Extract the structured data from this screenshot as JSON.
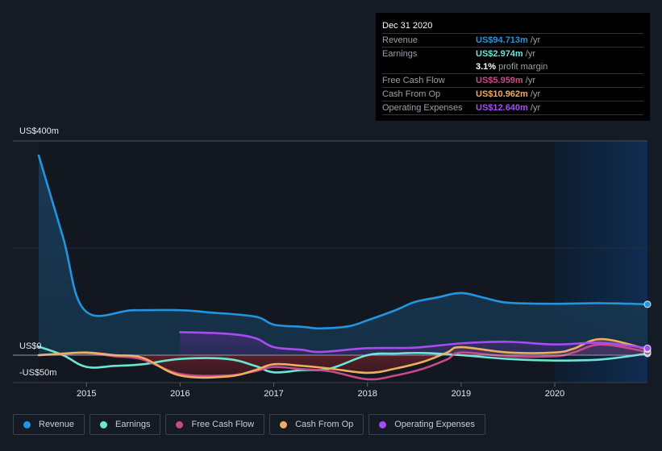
{
  "tooltip": {
    "date": "Dec 31 2020",
    "rows": [
      {
        "label": "Revenue",
        "value": "US$94.713m",
        "unit": " /yr",
        "color": "#2394df"
      },
      {
        "label": "Earnings",
        "value": "US$2.974m",
        "unit": " /yr",
        "color": "#6ce5d5"
      },
      {
        "label": "",
        "value": "3.1%",
        "unit": " profit margin",
        "color": "#ffffff"
      },
      {
        "label": "Free Cash Flow",
        "value": "US$5.959m",
        "unit": " /yr",
        "color": "#c9498b"
      },
      {
        "label": "Cash From Op",
        "value": "US$10.962m",
        "unit": " /yr",
        "color": "#eeae5e"
      },
      {
        "label": "Operating Expenses",
        "value": "US$12.640m",
        "unit": " /yr",
        "color": "#a64cf0"
      }
    ]
  },
  "legend": [
    {
      "label": "Revenue",
      "color": "#2394df"
    },
    {
      "label": "Earnings",
      "color": "#6ce5d5"
    },
    {
      "label": "Free Cash Flow",
      "color": "#c9498b"
    },
    {
      "label": "Cash From Op",
      "color": "#eeae5e"
    },
    {
      "label": "Operating Expenses",
      "color": "#a64cf0"
    }
  ],
  "chart_data": {
    "type": "line",
    "title": "",
    "xlabel": "",
    "ylabel": "",
    "ylim": [
      -50,
      400
    ],
    "xlim": [
      2014.49,
      2020.99
    ],
    "y_ticks": [
      {
        "value": 400,
        "label": "US$400m"
      },
      {
        "value": 0,
        "label": "US$0"
      },
      {
        "value": -50,
        "label": "-US$50m"
      }
    ],
    "x_ticks": [
      {
        "value": 2015,
        "label": "2015"
      },
      {
        "value": 2016,
        "label": "2016"
      },
      {
        "value": 2017,
        "label": "2017"
      },
      {
        "value": 2018,
        "label": "2018"
      },
      {
        "value": 2019,
        "label": "2019"
      },
      {
        "value": 2020,
        "label": "2020"
      }
    ],
    "highlight_from": 2020.0,
    "grid": true,
    "legend_position": "bottom-left",
    "series": [
      {
        "name": "Revenue",
        "color": "#2394df",
        "x": [
          2014.49,
          2014.75,
          2014.98,
          2015.5,
          2016.0,
          2016.3,
          2016.8,
          2017.0,
          2017.3,
          2017.5,
          2017.8,
          2018.0,
          2018.3,
          2018.5,
          2018.75,
          2019.0,
          2019.25,
          2019.5,
          2020.0,
          2020.5,
          2020.99
        ],
        "y": [
          373,
          220,
          84,
          84,
          84,
          80,
          72,
          57,
          53,
          50,
          54,
          65,
          84,
          99,
          108,
          116,
          107,
          98,
          96,
          97,
          95
        ]
      },
      {
        "name": "Earnings",
        "color": "#6ce5d5",
        "x": [
          2014.49,
          2014.75,
          2015.0,
          2015.3,
          2015.6,
          2016.0,
          2016.5,
          2016.8,
          2017.0,
          2017.3,
          2017.6,
          2018.0,
          2018.3,
          2018.6,
          2019.0,
          2019.5,
          2020.0,
          2020.5,
          2020.99
        ],
        "y": [
          16,
          0,
          -22,
          -20,
          -17,
          -7,
          -7,
          -20,
          -32,
          -28,
          -25,
          0,
          3,
          4,
          0,
          -7,
          -10,
          -8,
          3
        ]
      },
      {
        "name": "Free Cash Flow",
        "color": "#c9498b",
        "x": [
          2014.49,
          2014.75,
          2015.0,
          2015.3,
          2015.6,
          2016.0,
          2016.5,
          2016.8,
          2017.0,
          2017.3,
          2017.6,
          2018.0,
          2018.3,
          2018.6,
          2018.85,
          2019.0,
          2019.5,
          2020.0,
          2020.2,
          2020.5,
          2020.99
        ],
        "y": [
          0,
          2,
          4,
          -2,
          -8,
          -35,
          -38,
          -30,
          -22,
          -26,
          -30,
          -45,
          -38,
          -25,
          -8,
          5,
          -2,
          -2,
          5,
          20,
          6
        ]
      },
      {
        "name": "Cash From Op",
        "color": "#eeae5e",
        "x": [
          2014.49,
          2014.75,
          2015.0,
          2015.3,
          2015.6,
          2016.0,
          2016.5,
          2016.8,
          2017.0,
          2017.3,
          2017.6,
          2018.0,
          2018.3,
          2018.6,
          2018.85,
          2019.0,
          2019.5,
          2020.0,
          2020.2,
          2020.5,
          2020.99
        ],
        "y": [
          0,
          3,
          5,
          0,
          -5,
          -38,
          -40,
          -28,
          -17,
          -20,
          -25,
          -33,
          -25,
          -12,
          5,
          15,
          5,
          5,
          12,
          30,
          11
        ]
      },
      {
        "name": "Operating Expenses",
        "color": "#a64cf0",
        "x": [
          2016.0,
          2016.5,
          2016.8,
          2017.0,
          2017.3,
          2017.5,
          2018.0,
          2018.5,
          2019.0,
          2019.5,
          2020.0,
          2020.5,
          2020.99
        ],
        "y": [
          43,
          40,
          32,
          15,
          10,
          6,
          13,
          14,
          22,
          25,
          20,
          23,
          13
        ]
      }
    ]
  }
}
